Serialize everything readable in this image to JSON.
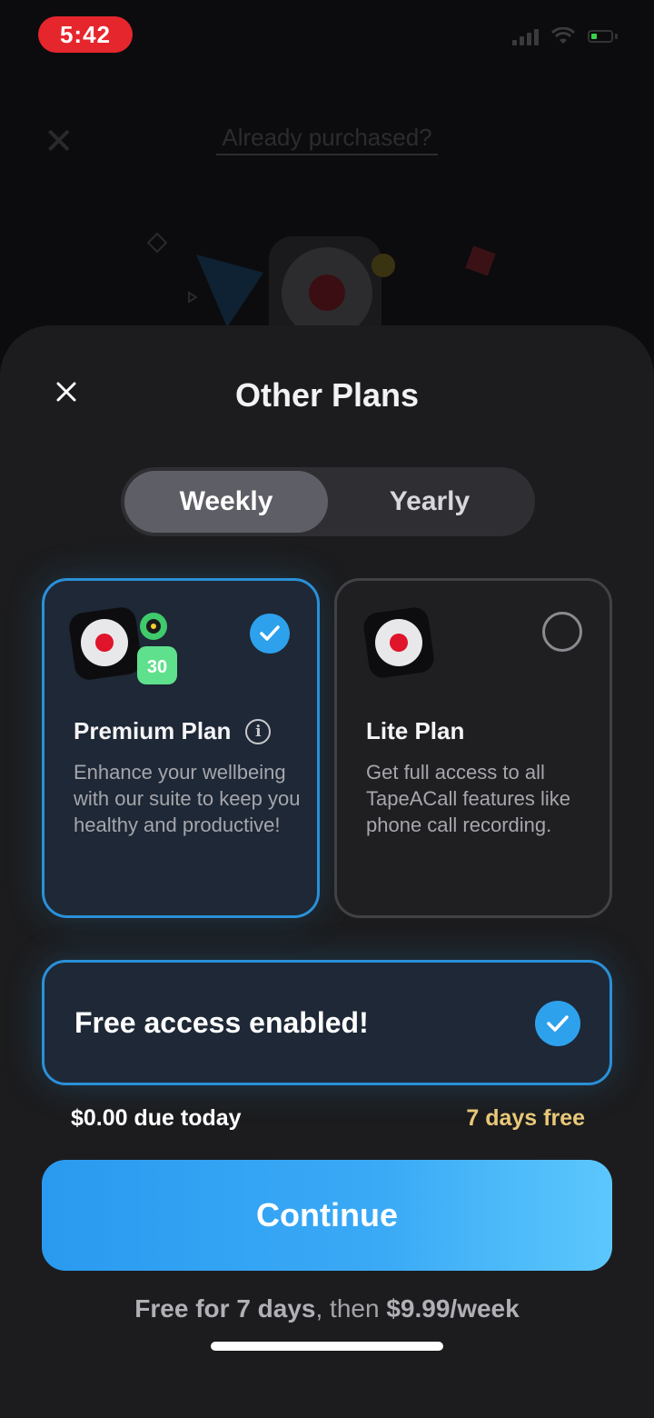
{
  "status_bar": {
    "time": "5:42"
  },
  "background": {
    "link": "Already purchased?"
  },
  "sheet": {
    "title": "Other Plans",
    "tabs": [
      {
        "label": "Weekly",
        "selected": true
      },
      {
        "label": "Yearly",
        "selected": false
      }
    ],
    "plans": [
      {
        "name": "Premium Plan",
        "description": "Enhance your wellbeing with our suite to keep you healthy and productive!",
        "selected": true,
        "badge_text": "30"
      },
      {
        "name": "Lite Plan",
        "description": "Get full access to all TapeACall features like phone call recording.",
        "selected": false
      }
    ],
    "free_access": {
      "label": "Free access enabled!",
      "enabled": true
    },
    "due_today": "$0.00 due today",
    "trial_label": "7 days free",
    "continue_label": "Continue",
    "terms": {
      "part1": "Free for 7 days",
      "part2": ", then ",
      "part3": "$9.99/week"
    }
  },
  "colors": {
    "accent": "#2ea1ec",
    "sheet_bg": "#1c1c1e",
    "trial_gold": "#e8c878",
    "record_red": "#e0142a"
  }
}
